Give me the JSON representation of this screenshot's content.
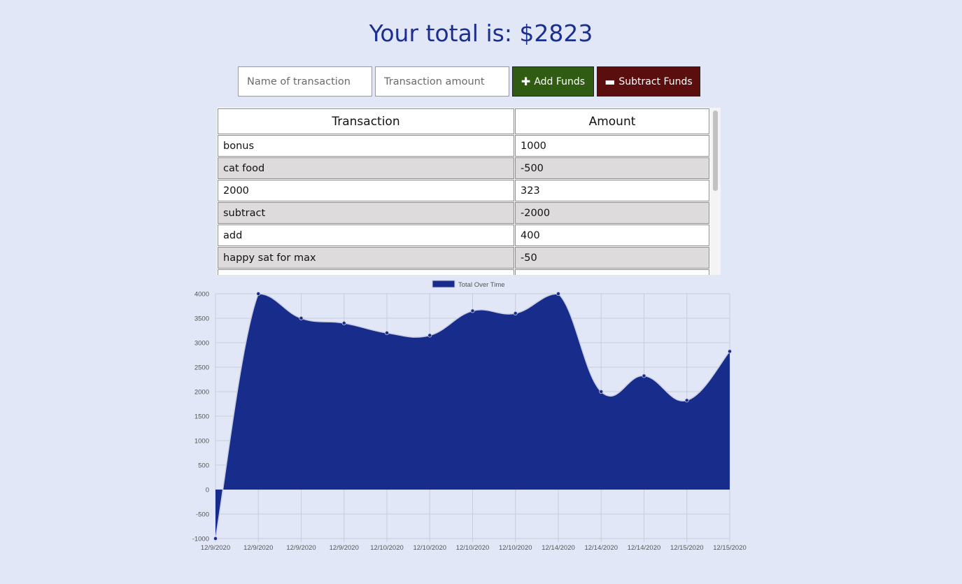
{
  "header": {
    "total_text": "Your total is: $2823"
  },
  "form": {
    "name_placeholder": "Name of transaction",
    "amount_placeholder": "Transaction amount",
    "add_label": "Add Funds",
    "add_icon": "plus-icon",
    "subtract_label": "Subtract Funds",
    "subtract_icon": "minus-icon",
    "add_color": "#2f5b12",
    "subtract_color": "#5a0e0e"
  },
  "table": {
    "headers": [
      "Transaction",
      "Amount"
    ],
    "rows": [
      {
        "name": "bonus",
        "amount": "1000"
      },
      {
        "name": "cat food",
        "amount": "-500"
      },
      {
        "name": "2000",
        "amount": "323"
      },
      {
        "name": "subtract",
        "amount": "-2000"
      },
      {
        "name": "add",
        "amount": "400"
      },
      {
        "name": "happy sat for max",
        "amount": "-50"
      }
    ]
  },
  "chart_data": {
    "type": "area",
    "legend": "Total Over Time",
    "legend_position": "top",
    "grid": true,
    "color": "#182d8b",
    "x": [
      "12/9/2020",
      "12/9/2020",
      "12/9/2020",
      "12/9/2020",
      "12/10/2020",
      "12/10/2020",
      "12/10/2020",
      "12/10/2020",
      "12/14/2020",
      "12/14/2020",
      "12/14/2020",
      "12/15/2020",
      "12/15/2020"
    ],
    "values": [
      -1000,
      4000,
      3500,
      3400,
      3200,
      3150,
      3650,
      3600,
      4000,
      2000,
      2323,
      1823,
      2823
    ],
    "ylim": [
      -1000,
      4000
    ],
    "yticks": [
      4000,
      3500,
      3000,
      2500,
      2000,
      1500,
      1000,
      500,
      0,
      -500,
      -1000
    ]
  }
}
